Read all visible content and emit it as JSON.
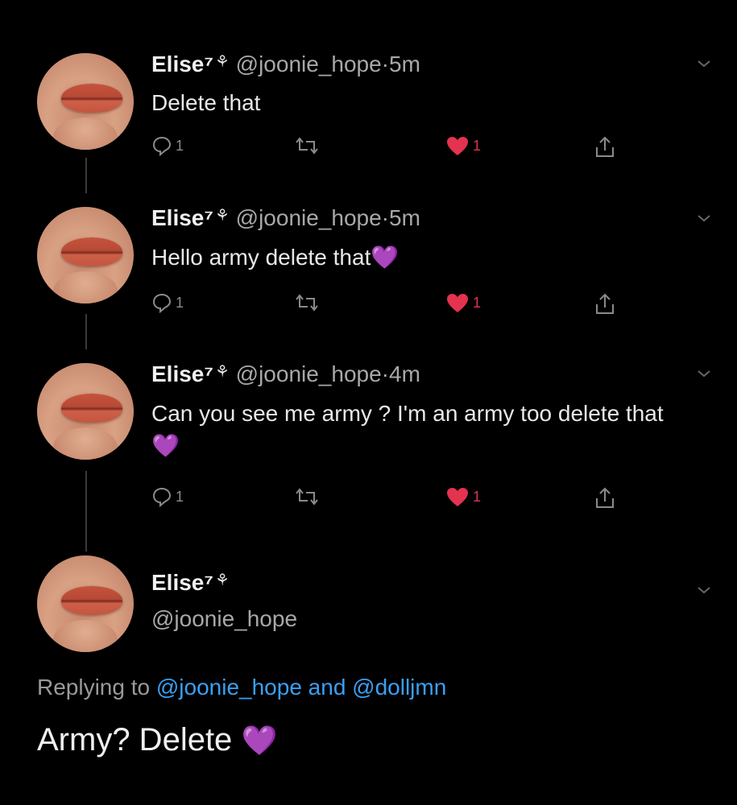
{
  "tweets": [
    {
      "name": "Elise⁷",
      "badge": "⚘",
      "handle": "@joonie_hope",
      "sep": "·",
      "time": "5m",
      "text": "Delete that",
      "emoji": "",
      "reply_count": "1",
      "like_count": "1"
    },
    {
      "name": "Elise⁷",
      "badge": "⚘",
      "handle": "@joonie_hope",
      "sep": "·",
      "time": "5m",
      "text": "Hello army delete that",
      "emoji": "💜",
      "reply_count": "1",
      "like_count": "1"
    },
    {
      "name": "Elise⁷",
      "badge": "⚘",
      "handle": "@joonie_hope",
      "sep": "·",
      "time": "4m",
      "text": "Can you see me army ? I'm an army too delete that",
      "emoji": "💜",
      "reply_count": "1",
      "like_count": "1"
    }
  ],
  "main_tweet": {
    "name": "Elise⁷",
    "badge": "⚘",
    "handle": "@joonie_hope",
    "replying_prefix": "Replying to",
    "replying_to_1": "@joonie_hope",
    "replying_and": "and",
    "replying_to_2": "@dolljmn",
    "text": "Army? Delete",
    "emoji": "💜"
  },
  "colors": {
    "background": "#000000",
    "like_red": "#e3334f",
    "mention_blue": "#3b9ff3",
    "heart_purple": "#a56cf0"
  },
  "icons": [
    "reply-icon",
    "retweet-icon",
    "like-icon",
    "share-icon",
    "chevron-down-icon"
  ]
}
